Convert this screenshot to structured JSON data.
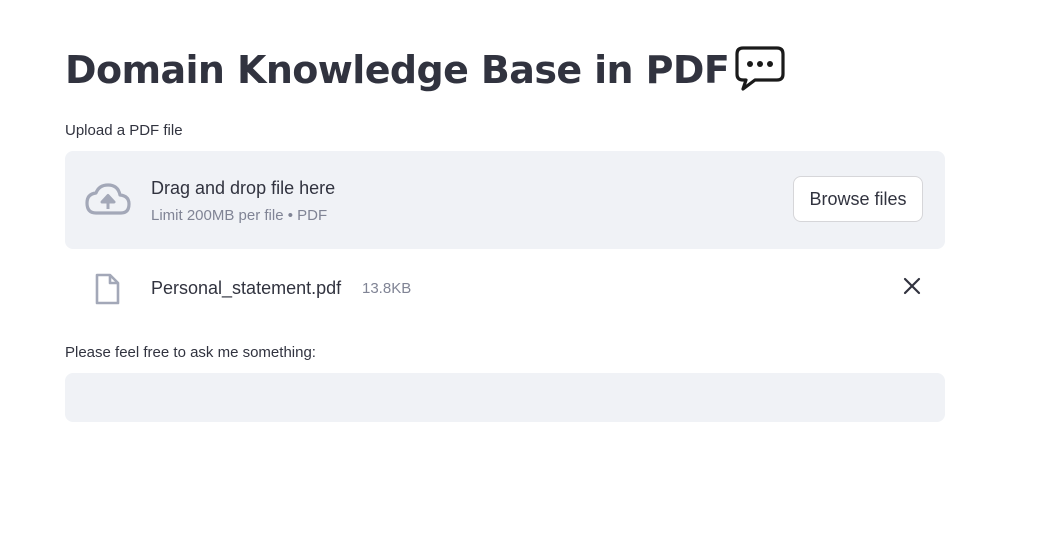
{
  "page": {
    "title": "Domain Knowledge Base in PDF",
    "title_emoji": "speech-balloon-icon"
  },
  "uploader": {
    "label": "Upload a PDF file",
    "drop_instruction": "Drag and drop file here",
    "limit_text": "Limit 200MB per file • PDF",
    "browse_label": "Browse files",
    "icons": {
      "cloud": "cloud-upload-icon",
      "file": "file-icon",
      "remove": "close-icon"
    }
  },
  "uploaded_file": {
    "name": "Personal_statement.pdf",
    "size": "13.8KB"
  },
  "question": {
    "label": "Please feel free to ask me something:",
    "value": ""
  },
  "colors": {
    "text": "#31333f",
    "muted_text": "#808495",
    "surface": "#f0f2f6",
    "icon": "#a3a8b8",
    "button_border": "#d6d6d9"
  }
}
